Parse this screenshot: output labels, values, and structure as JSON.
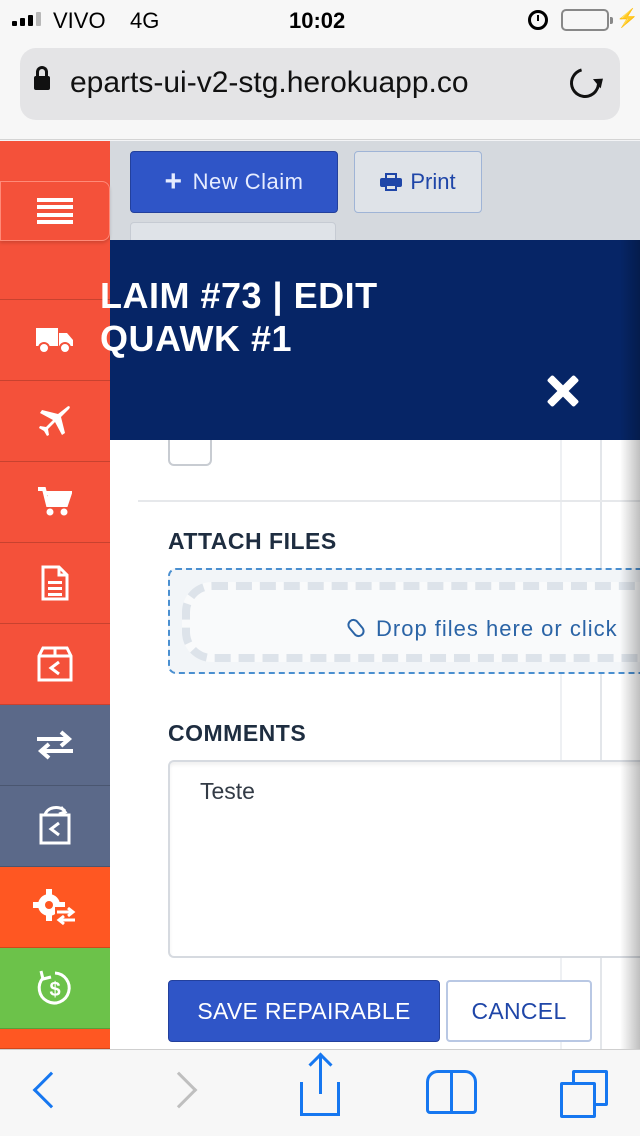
{
  "status_bar": {
    "carrier": "VIVO",
    "network": "4G",
    "time": "10:02"
  },
  "browser": {
    "url": "eparts-ui-v2-stg.herokuapp.co"
  },
  "toolbar": {
    "new_claim_icon": "+",
    "new_claim_label": "New Claim",
    "print_label": "Print"
  },
  "sidebar": {
    "items": [
      {
        "icon": "truck-icon",
        "color": "#f4513a"
      },
      {
        "icon": "airplane-icon",
        "color": "#f4513a"
      },
      {
        "icon": "cart-icon",
        "color": "#f4513a"
      },
      {
        "icon": "document-icon",
        "color": "#f4513a"
      },
      {
        "icon": "return-box-icon",
        "color": "#f4513a"
      },
      {
        "icon": "exchange-icon",
        "color": "#5b6989"
      },
      {
        "icon": "return-doc-icon",
        "color": "#5b6989"
      },
      {
        "icon": "gear-exchange-icon",
        "color": "#ff5722"
      },
      {
        "icon": "dollar-cycle-icon",
        "color": "#6cc24a"
      }
    ]
  },
  "modal": {
    "title_line1": "LAIM #73 | EDIT",
    "title_line2": "QUAWK #1",
    "attach_label": "ATTACH FILES",
    "dropzone_text": "Drop files here or click",
    "comments_label": "COMMENTS",
    "comments_value": "Teste",
    "save_label": "SAVE REPAIRABLE",
    "cancel_label": "CANCEL"
  },
  "colors": {
    "accent": "#2f55c7",
    "modal_header": "#062566",
    "browser_blue": "#1677f0"
  }
}
